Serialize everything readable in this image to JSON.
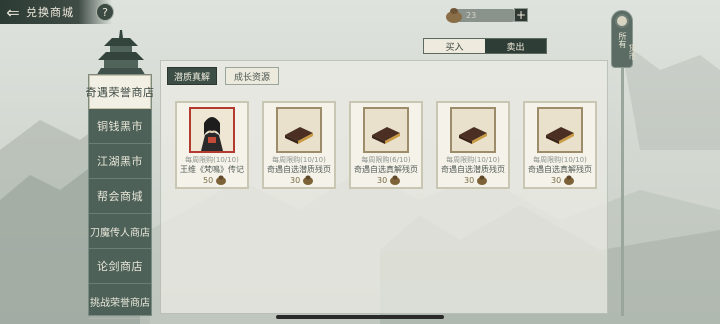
{
  "header": {
    "back_label": "⇐",
    "title": "兑换商城",
    "help_label": "?"
  },
  "currency": {
    "amount": "23",
    "plus_label": "+"
  },
  "trade": {
    "buy_label": "买入",
    "sell_label": "卖出",
    "active": "buy"
  },
  "right_scroll": {
    "label_a": "所有",
    "label_b": "货币"
  },
  "sidebar": {
    "items": [
      {
        "label": "奇遇荣誉商店",
        "active": true
      },
      {
        "label": "铜钱黑市",
        "active": false
      },
      {
        "label": "江湖黑市",
        "active": false
      },
      {
        "label": "帮会商城",
        "active": false
      },
      {
        "label": "刀魔传人商店",
        "active": false
      },
      {
        "label": "论剑商店",
        "active": false
      },
      {
        "label": "挑战荣誉商店",
        "active": false
      }
    ]
  },
  "sub_tabs": [
    {
      "label": "潜质真解",
      "active": true
    },
    {
      "label": "成长资源",
      "active": false
    }
  ],
  "items": [
    {
      "limit": "每周限购(10/10)",
      "name": "王维《梵鳴》传记",
      "price": "50",
      "icon": "hero-portrait"
    },
    {
      "limit": "每周限购(10/10)",
      "name": "奇遇自选潜质残页",
      "price": "30",
      "icon": "book-icon"
    },
    {
      "limit": "每周限购(6/10)",
      "name": "奇遇自选真解残页",
      "price": "30",
      "icon": "book-icon"
    },
    {
      "limit": "每周限购(10/10)",
      "name": "奇遇自选潜质残页",
      "price": "30",
      "icon": "book-icon"
    },
    {
      "limit": "每周限购(10/10)",
      "name": "奇遇自选真解残页",
      "price": "30",
      "icon": "book-icon"
    }
  ],
  "colors": {
    "sidebar_bg": "#4d6158",
    "active_tab": "#3d4e46",
    "card_border": "#c9c6b4"
  }
}
